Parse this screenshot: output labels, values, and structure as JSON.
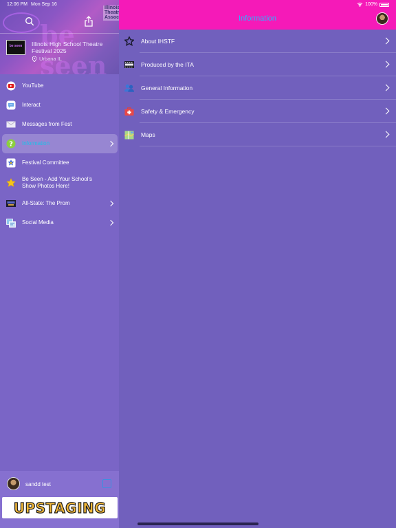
{
  "status": {
    "time": "12:06 PM",
    "date": "Mon Sep 16",
    "battery": "100%"
  },
  "sidebar": {
    "header": {
      "festival_title": "Illinois High School Theatre Festival 2025",
      "location": "Urbana IL",
      "logo_text": "be seen",
      "banner_text": "be seen",
      "corner_badge_text": "Illinois Theatre Association"
    },
    "items": [
      {
        "label": "YouTube",
        "icon": "youtube-icon"
      },
      {
        "label": "Interact",
        "icon": "chat-bubble-icon"
      },
      {
        "label": "Messages from Fest",
        "icon": "envelope-icon"
      },
      {
        "label": "Information",
        "icon": "question-icon",
        "selected": true
      },
      {
        "label": "Festival Committee",
        "icon": "star-badge-icon"
      },
      {
        "label": "Be Seen - Add Your School's Show Photos Here!",
        "icon": "star-icon"
      },
      {
        "label": "All-State: The Prom",
        "icon": "prom-thumbnail-icon"
      },
      {
        "label": "Social Media",
        "icon": "social-media-icon"
      }
    ],
    "footer": {
      "user_name": "sandd test",
      "banner_text": "UPSTAGING"
    }
  },
  "main": {
    "title": "Information",
    "rows": [
      {
        "label": "About IHSTF",
        "icon": "star-outline-icon"
      },
      {
        "label": "Produced by the ITA",
        "icon": "film-strip-icon"
      },
      {
        "label": "General Information",
        "icon": "people-icon"
      },
      {
        "label": "Safety & Emergency",
        "icon": "first-aid-icon"
      },
      {
        "label": "Maps",
        "icon": "map-icon"
      }
    ]
  },
  "colors": {
    "topbar": "#f51ab8",
    "title_accent": "#28b6ff",
    "background": "#7160bd",
    "selected_label": "#1ec0e8"
  }
}
